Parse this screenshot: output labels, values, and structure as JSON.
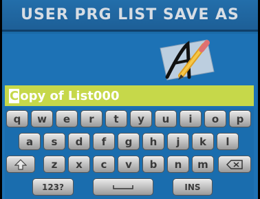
{
  "title": "USER PRG LIST SAVE AS",
  "entry": {
    "cursor_char": "C",
    "value_rest": "opy of List000"
  },
  "keyboard": {
    "row1": [
      "q",
      "w",
      "e",
      "r",
      "t",
      "y",
      "u",
      "i",
      "o",
      "p"
    ],
    "row2": [
      "a",
      "s",
      "d",
      "f",
      "g",
      "h",
      "j",
      "k",
      "l"
    ],
    "row3": [
      "z",
      "x",
      "c",
      "v",
      "b",
      "n",
      "m"
    ],
    "numbers_label": "123?",
    "ins_label": "INS"
  },
  "icons": {
    "shift": "shift-icon",
    "backspace": "backspace-icon",
    "space": "space-icon",
    "logo": "pen-logo-icon"
  },
  "colors": {
    "background": "#1d72b5",
    "entry_field": "#c6d84a",
    "title_text": "#d7dde4"
  }
}
